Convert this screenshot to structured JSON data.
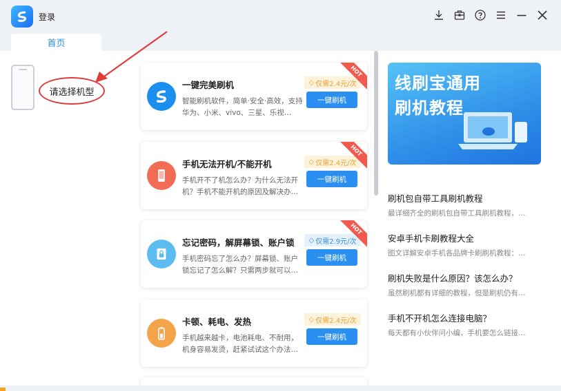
{
  "titlebar": {
    "login_label": "登录",
    "icons": [
      "download-icon",
      "toolbox-icon",
      "help-icon",
      "menu-icon",
      "minimize-icon",
      "close-icon"
    ]
  },
  "tabs": [
    {
      "label": "首页",
      "active": true
    }
  ],
  "left": {
    "select_model_label": "请选择机型"
  },
  "cards": [
    {
      "title": "一键完美刷机",
      "desc": "智能刷机软件，简单·安全·高效，支持华为、小米、vivo、三星、乐视…",
      "price": "仅需2.4元/次",
      "price_style": "orange",
      "button": "一键刷机",
      "hot": "HOT",
      "icon": "app-logo-icon",
      "icon_color": "#1a8ff0"
    },
    {
      "title": "手机无法开机/不能开机",
      "desc": "手机开不了机怎么办？为什么无法开机？手机不能开机的原因及解决办…",
      "price": "仅需2.4元/次",
      "price_style": "orange",
      "button": "一键刷机",
      "hot": "HOT",
      "icon": "phone-icon",
      "icon_color": "#f26b55"
    },
    {
      "title": "忘记密码，解屏幕锁、账户锁",
      "desc": "手机密码忘了怎么办？屏幕锁、账户锁忘记了怎么解？只需两步就可以…",
      "price": "仅需2.9元/次",
      "price_style": "blue",
      "button": "一键刷机",
      "hot": "HOT",
      "icon": "lock-icon",
      "icon_color": "#5cbcf2"
    },
    {
      "title": "卡顿、耗电、发热",
      "desc": "手机越来越卡，电池耗电、不耐用，机身容易发烫，赶紧试试这个办法…",
      "price": "仅需2.4元/次",
      "price_style": "orange",
      "button": "一键刷机",
      "hot": "",
      "icon": "battery-icon",
      "icon_color": "#f5a449"
    }
  ],
  "banner": {
    "line1": "线刷宝通用",
    "line2": "刷机教程"
  },
  "articles": [
    {
      "title": "刷机包自带工具刷机教程",
      "desc": "最详细齐全的刷机包自带工具刷机教程，…"
    },
    {
      "title": "安卓手机卡刷教程大全",
      "desc": "图文详解安卓手机各品牌卡刷刷机教程：…"
    },
    {
      "title": "刷机失败是什么原因？该怎么办？",
      "desc": "虽然刷机都有详细的教程，但是刷机仍有…"
    },
    {
      "title": "手机不开机怎么连接电脑？",
      "desc": "每天都有小伙伴问小编，手机要怎么链接…"
    }
  ],
  "colors": {
    "accent": "#2a8ff0",
    "hot": "#f05a4f",
    "annotation": "#e03a3a"
  }
}
